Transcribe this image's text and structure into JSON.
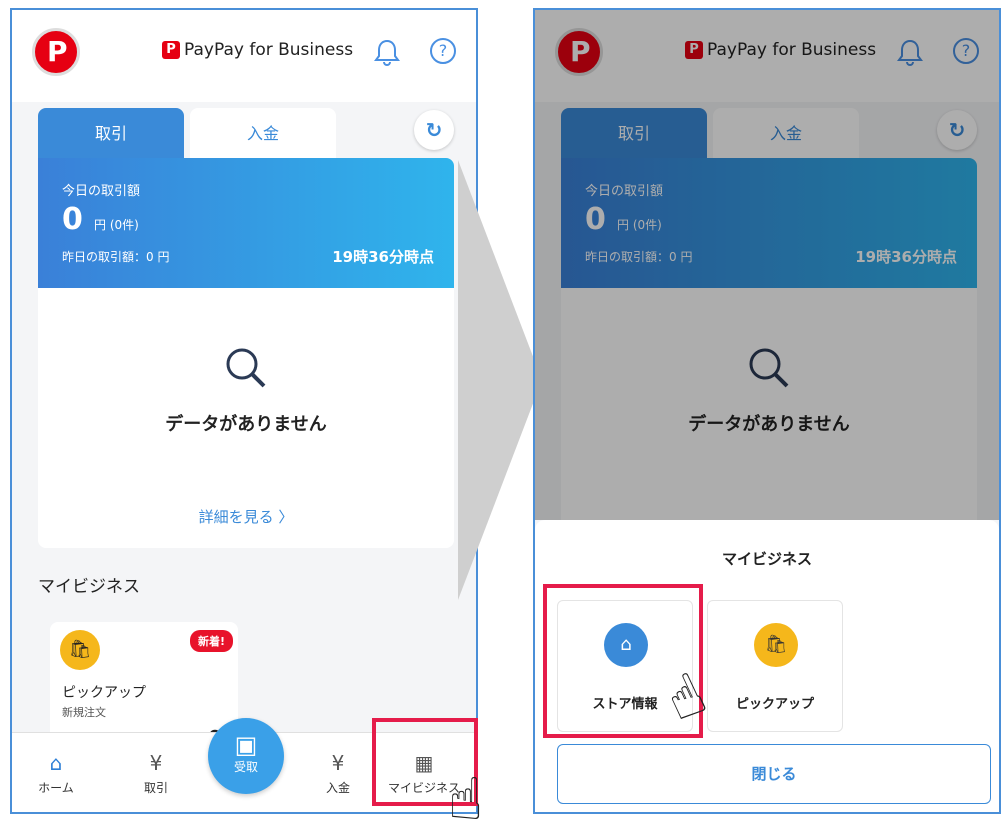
{
  "header": {
    "brand": "PayPay for Business",
    "brand_mark": "P",
    "help": "?"
  },
  "tabs": {
    "active": "取引",
    "inactive": "入金"
  },
  "summary": {
    "today_label": "今日の取引額",
    "amount": "0",
    "amount_unit": "円 (0件)",
    "yesterday": "昨日の取引額：0 円",
    "time": "19時36分時点"
  },
  "empty": {
    "message": "データがありません",
    "detail_link": "詳細を見る 〉"
  },
  "mybiz": {
    "title": "マイビジネス",
    "card": {
      "name": "ピックアップ",
      "sub": "新規注文",
      "badge": "新着!",
      "count": "0"
    }
  },
  "nav": {
    "home": "ホーム",
    "transactions": "取引",
    "scan": "受取",
    "deposit": "入金",
    "mybiz": "マイビジネス"
  },
  "sheet": {
    "title": "マイビジネス",
    "option1": "ストア情報",
    "option2": "ピックアップ",
    "close": "閉じる"
  },
  "colors": {
    "accent": "#3a8ad8",
    "highlight": "#e51c4a",
    "brand": "#e60012",
    "pickup": "#f5b71b"
  }
}
